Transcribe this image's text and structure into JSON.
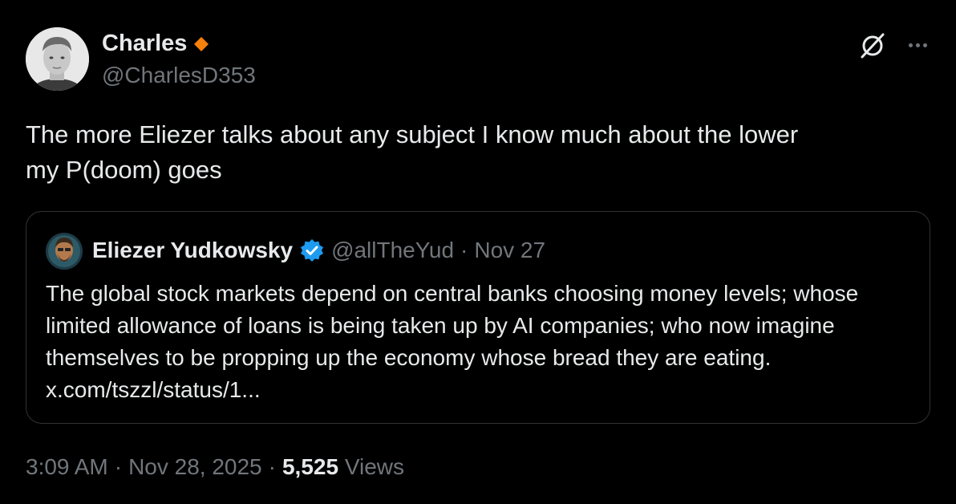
{
  "author": {
    "name": "Charles",
    "handle": "@CharlesD353",
    "badge_color": "#f5800b"
  },
  "icons": {
    "grok": "grok-icon",
    "more": "more-icon"
  },
  "tweet": {
    "text": "The more Eliezer talks about any subject I know much about the lower\nmy P(doom) goes"
  },
  "quote": {
    "name": "Eliezer Yudkowsky",
    "handle": "@allTheYud",
    "separator": "·",
    "date": "Nov 27",
    "verified_color": "#1d9bf0",
    "text": "The global stock markets depend on central banks choosing money levels; whose limited allowance of loans is being taken up by AI companies; who now imagine themselves to be propping up the economy whose bread they are eating. ",
    "link": "x.com/tszzl/status/1..."
  },
  "meta": {
    "time": "3:09 AM",
    "sep1": "·",
    "date": "Nov 28, 2025",
    "sep2": "·",
    "views_count": "5,525",
    "views_label": "Views"
  }
}
